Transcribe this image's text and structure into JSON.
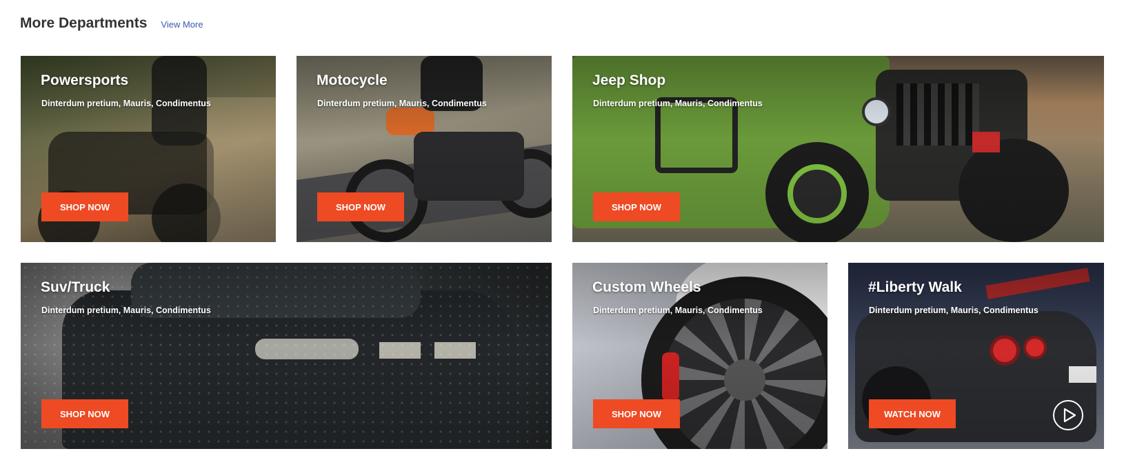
{
  "section": {
    "title": "More Departments",
    "view_more": "View More"
  },
  "cards": [
    {
      "title": "Powersports",
      "subtitle": "Dinterdum pretium, Mauris, Condimentus",
      "button": "SHOP NOW"
    },
    {
      "title": "Motocycle",
      "subtitle": "Dinterdum pretium, Mauris, Condimentus",
      "button": "SHOP NOW"
    },
    {
      "title": "Jeep Shop",
      "subtitle": "Dinterdum pretium, Mauris, Condimentus",
      "button": "SHOP NOW"
    },
    {
      "title": "Suv/Truck",
      "subtitle": "Dinterdum pretium, Mauris, Condimentus",
      "button": "SHOP NOW"
    },
    {
      "title": "Custom Wheels",
      "subtitle": "Dinterdum pretium, Mauris, Condimentus",
      "button": "SHOP NOW"
    },
    {
      "title": "#Liberty Walk",
      "subtitle": "Dinterdum pretium, Mauris, Condimentus",
      "button": "WATCH NOW"
    }
  ],
  "icons": {
    "play": "play-circle-icon"
  },
  "colors": {
    "accent": "#ee4a24",
    "link": "#3a5ba8",
    "heading": "#333333"
  }
}
